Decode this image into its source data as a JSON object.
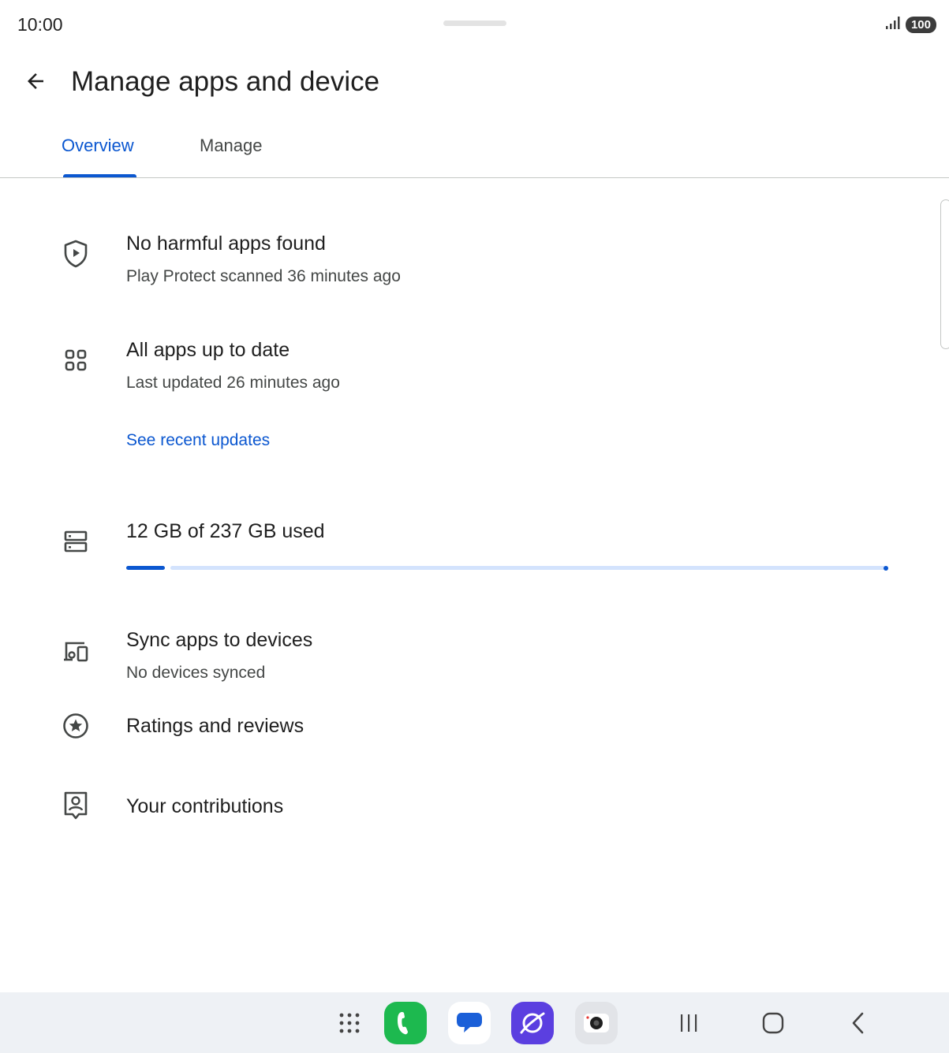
{
  "status_bar": {
    "time": "10:00",
    "battery": "100"
  },
  "header": {
    "title": "Manage apps and device"
  },
  "tabs": [
    {
      "label": "Overview",
      "selected": true
    },
    {
      "label": "Manage",
      "selected": false
    }
  ],
  "sections": {
    "protect": {
      "title": "No harmful apps found",
      "subtitle": "Play Protect scanned 36 minutes ago"
    },
    "updates": {
      "title": "All apps up to date",
      "subtitle": "Last updated 26 minutes ago",
      "link": "See recent updates"
    },
    "storage": {
      "title": "12 GB of 237 GB used",
      "used_gb": 12,
      "total_gb": 237
    },
    "sync": {
      "title": "Sync apps to devices",
      "subtitle": "No devices synced"
    },
    "ratings": {
      "title": "Ratings and reviews"
    },
    "contributions": {
      "title": "Your contributions"
    }
  },
  "colors": {
    "accent": "#0b57d0",
    "progress_track": "#d3e3fd",
    "navbar_bg": "#eef1f5",
    "phone_app": "#1db94f",
    "messages_app": "#1a5fd8",
    "internet_app": "#5b3fe0"
  },
  "navbar": {
    "icons": [
      "app-drawer-icon",
      "phone-app-icon",
      "messages-app-icon",
      "internet-app-icon",
      "camera-app-icon",
      "recents-icon",
      "home-icon",
      "back-nav-icon"
    ]
  }
}
